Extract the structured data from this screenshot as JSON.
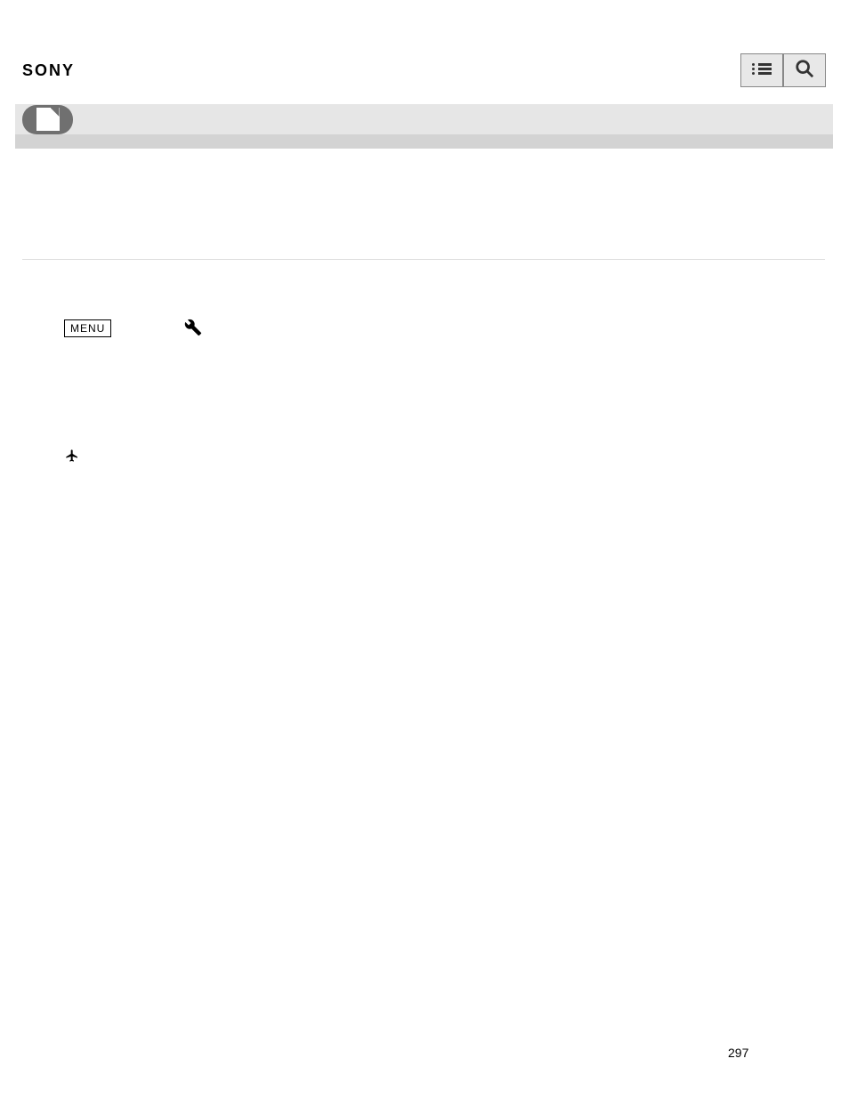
{
  "header": {
    "brand": "SONY",
    "list_icon_name": "list-icon",
    "search_icon_name": "search-icon"
  },
  "subheader": {
    "doc_icon_name": "document-icon"
  },
  "content": {
    "menu_label": "MENU",
    "wrench_icon_name": "wrench-icon",
    "airplane_icon_name": "airplane-icon"
  },
  "footer": {
    "page_number": "297"
  }
}
